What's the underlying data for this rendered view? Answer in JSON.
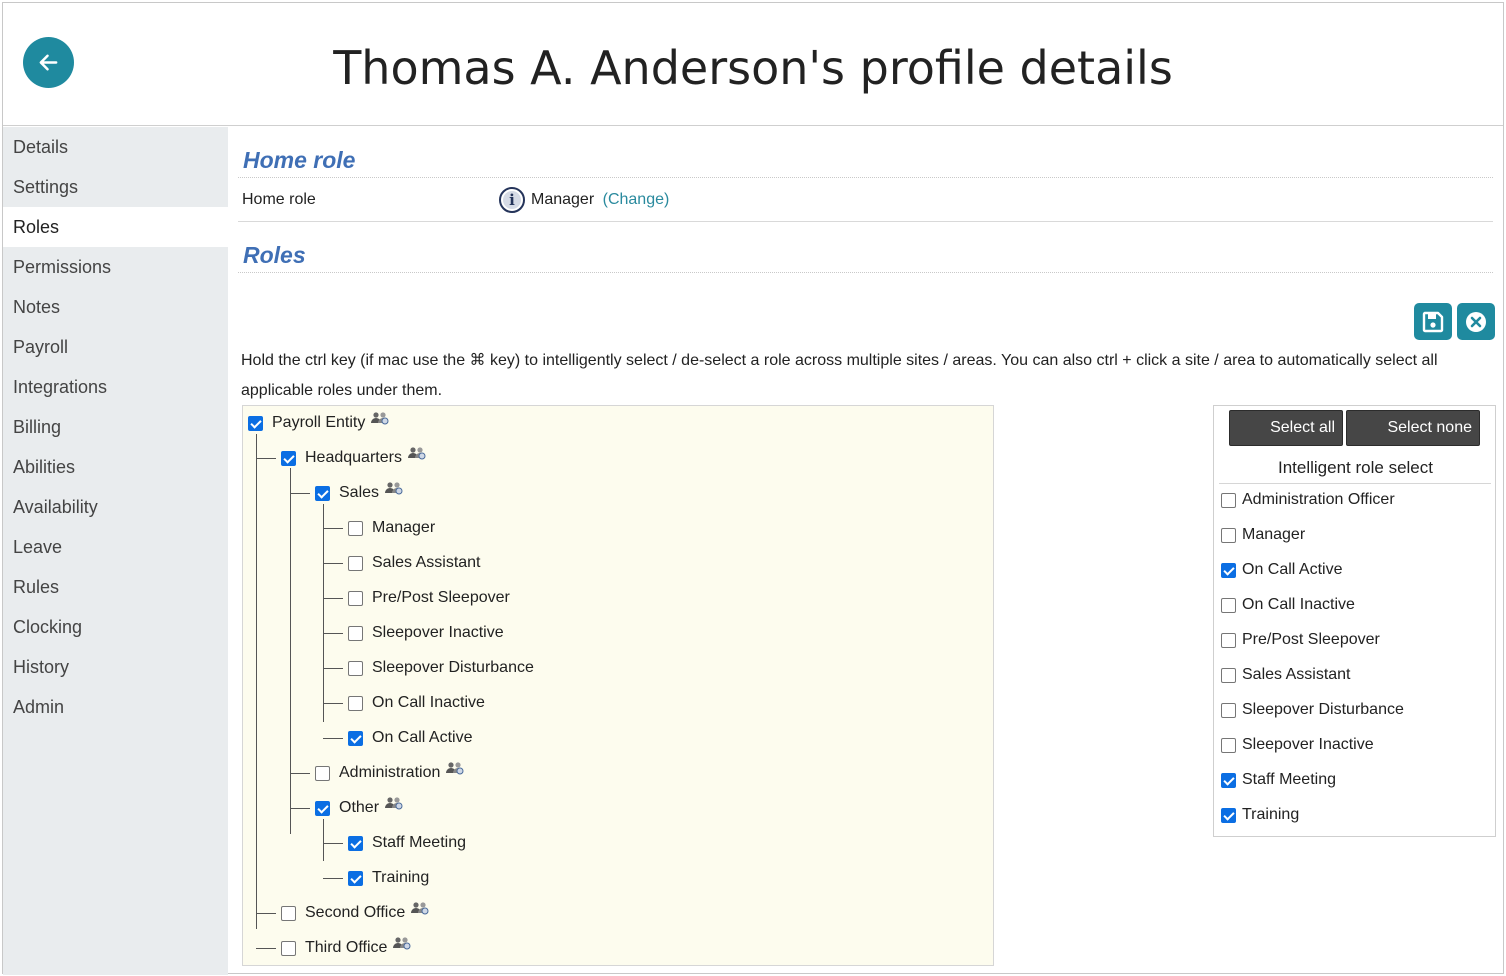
{
  "header": {
    "title": "Thomas A. Anderson's profile details"
  },
  "sidebar": {
    "items": [
      {
        "label": "Details"
      },
      {
        "label": "Settings"
      },
      {
        "label": "Roles"
      },
      {
        "label": "Permissions"
      },
      {
        "label": "Notes"
      },
      {
        "label": "Payroll"
      },
      {
        "label": "Integrations"
      },
      {
        "label": "Billing"
      },
      {
        "label": "Abilities"
      },
      {
        "label": "Availability"
      },
      {
        "label": "Leave"
      },
      {
        "label": "Rules"
      },
      {
        "label": "Clocking"
      },
      {
        "label": "History"
      },
      {
        "label": "Admin"
      }
    ],
    "active": "Roles"
  },
  "home_role": {
    "section_title": "Home role",
    "label": "Home role",
    "value": "Manager",
    "change_link": "(Change)"
  },
  "roles": {
    "section_title": "Roles",
    "hint": "Hold the ctrl key (if mac use the ⌘ key) to intelligently select / de-select a role across multiple sites / areas. You can also ctrl + click a site / area to automatically select all applicable roles under them.",
    "tree": [
      {
        "label": "Payroll Entity",
        "checked": true,
        "group": true
      },
      {
        "label": "Headquarters",
        "checked": true,
        "group": true
      },
      {
        "label": "Sales",
        "checked": true,
        "group": true
      },
      {
        "label": "Manager",
        "checked": false,
        "group": false
      },
      {
        "label": "Sales Assistant",
        "checked": false,
        "group": false
      },
      {
        "label": "Pre/Post Sleepover",
        "checked": false,
        "group": false
      },
      {
        "label": "Sleepover Inactive",
        "checked": false,
        "group": false
      },
      {
        "label": "Sleepover Disturbance",
        "checked": false,
        "group": false
      },
      {
        "label": "On Call Inactive",
        "checked": false,
        "group": false
      },
      {
        "label": "On Call Active",
        "checked": true,
        "group": false
      },
      {
        "label": "Administration",
        "checked": false,
        "group": true
      },
      {
        "label": "Other",
        "checked": true,
        "group": true
      },
      {
        "label": "Staff Meeting",
        "checked": true,
        "group": false
      },
      {
        "label": "Training",
        "checked": true,
        "group": false
      },
      {
        "label": "Second Office",
        "checked": false,
        "group": true
      },
      {
        "label": "Third Office",
        "checked": false,
        "group": true
      }
    ]
  },
  "intelligent": {
    "select_all": "Select all",
    "select_none": "Select none",
    "title": "Intelligent role select",
    "items": [
      {
        "label": "Administration Officer",
        "checked": false
      },
      {
        "label": "Manager",
        "checked": false
      },
      {
        "label": "On Call Active",
        "checked": true
      },
      {
        "label": "On Call Inactive",
        "checked": false
      },
      {
        "label": "Pre/Post Sleepover",
        "checked": false
      },
      {
        "label": "Sales Assistant",
        "checked": false
      },
      {
        "label": "Sleepover Disturbance",
        "checked": false
      },
      {
        "label": "Sleepover Inactive",
        "checked": false
      },
      {
        "label": "Staff Meeting",
        "checked": true
      },
      {
        "label": "Training",
        "checked": true
      }
    ]
  },
  "icons": {
    "back": "arrow-left-icon",
    "info": "info-icon",
    "save": "save-icon",
    "cancel": "close-circle-icon",
    "group": "group-icon"
  },
  "colors": {
    "accent": "#1f8a9f",
    "section": "#3f6fb5",
    "checkbox": "#0b6ee3"
  }
}
